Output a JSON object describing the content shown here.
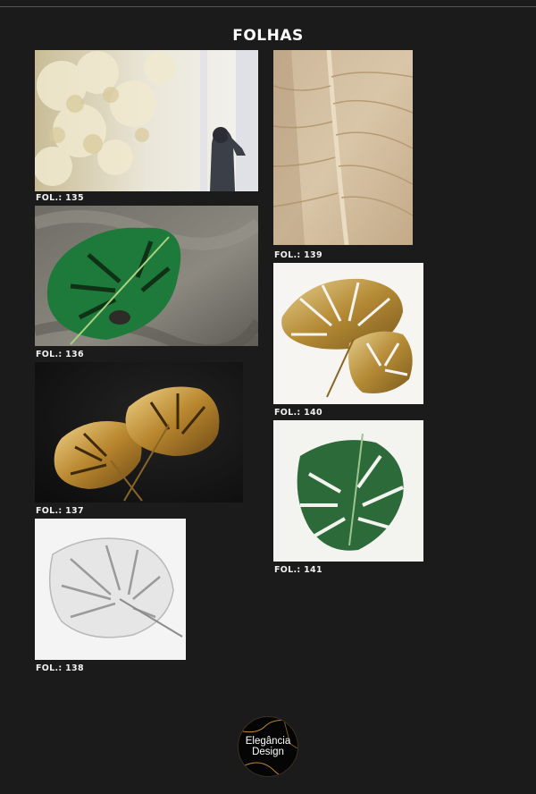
{
  "page": {
    "title": "FOLHAS"
  },
  "items": [
    {
      "caption": "FOL.: 135",
      "subject": "backlit pale foliage with person"
    },
    {
      "caption": "FOL.: 136",
      "subject": "green monstera leaf on grey fabric"
    },
    {
      "caption": "FOL.: 137",
      "subject": "gold monstera leaves on black"
    },
    {
      "caption": "FOL.: 138",
      "subject": "white monstera leaf"
    },
    {
      "caption": "FOL.: 139",
      "subject": "dry beige leaf close-up"
    },
    {
      "caption": "FOL.: 140",
      "subject": "gold monstera leaves on white"
    },
    {
      "caption": "FOL.: 141",
      "subject": "green monstera leaf on white"
    }
  ],
  "logo": {
    "line1": "Elegância",
    "line2": "Design"
  },
  "colors": {
    "background": "#1b1b1b",
    "caption_text": "#f1f1f1",
    "gold": "#c9a04a",
    "green": "#1f6b33"
  }
}
